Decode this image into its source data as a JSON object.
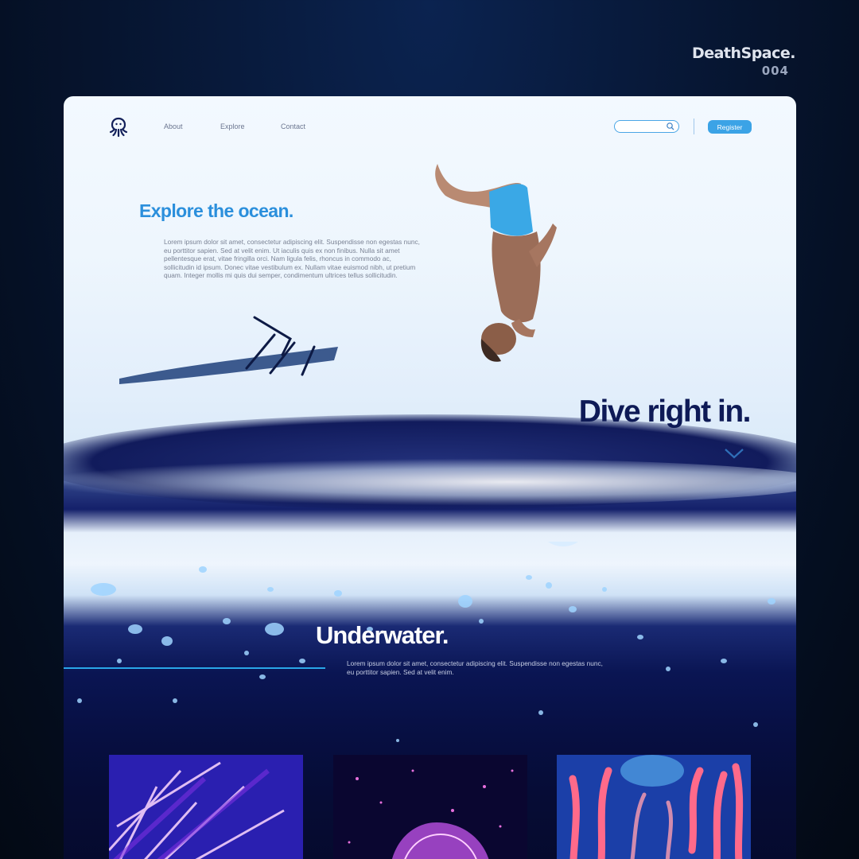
{
  "brand": {
    "name": "DeathSpace.",
    "number": "004"
  },
  "nav": {
    "links": [
      "About",
      "Explore",
      "Contact"
    ],
    "search": {
      "value": "",
      "placeholder": ""
    },
    "register_label": "Register"
  },
  "hero": {
    "title": "Explore the ocean.",
    "text": "Lorem ipsum dolor sit amet, consectetur adipiscing elit. Suspendisse non egestas nunc, eu porttitor sapien. Sed at velit enim. Ut iaculis quis ex non finibus. Nulla sit amet pellentesque erat, vitae fringilla orci. Nam ligula felis, rhoncus in commodo ac, sollicitudin id ipsum.  Donec vitae vestibulum ex. Nullam vitae euismod nibh, ut pretium quam. Integer mollis mi quis dui semper, condimentum ultrices tellus sollicitudin.",
    "dive_title": "Dive right in."
  },
  "underwater": {
    "title": "Underwater.",
    "text": "Lorem ipsum dolor sit amet, consectetur adipiscing elit. Suspendisse non egestas nunc, eu porttitor sapien. Sed at velit enim."
  },
  "icons": [
    "octopus-logo-icon",
    "search-icon",
    "chevron-down-icon"
  ],
  "colors": {
    "accent": "#3ba3e6",
    "hero_title": "#2b8fdc",
    "dark_navy": "#0e1a56",
    "background": "#06142e"
  }
}
